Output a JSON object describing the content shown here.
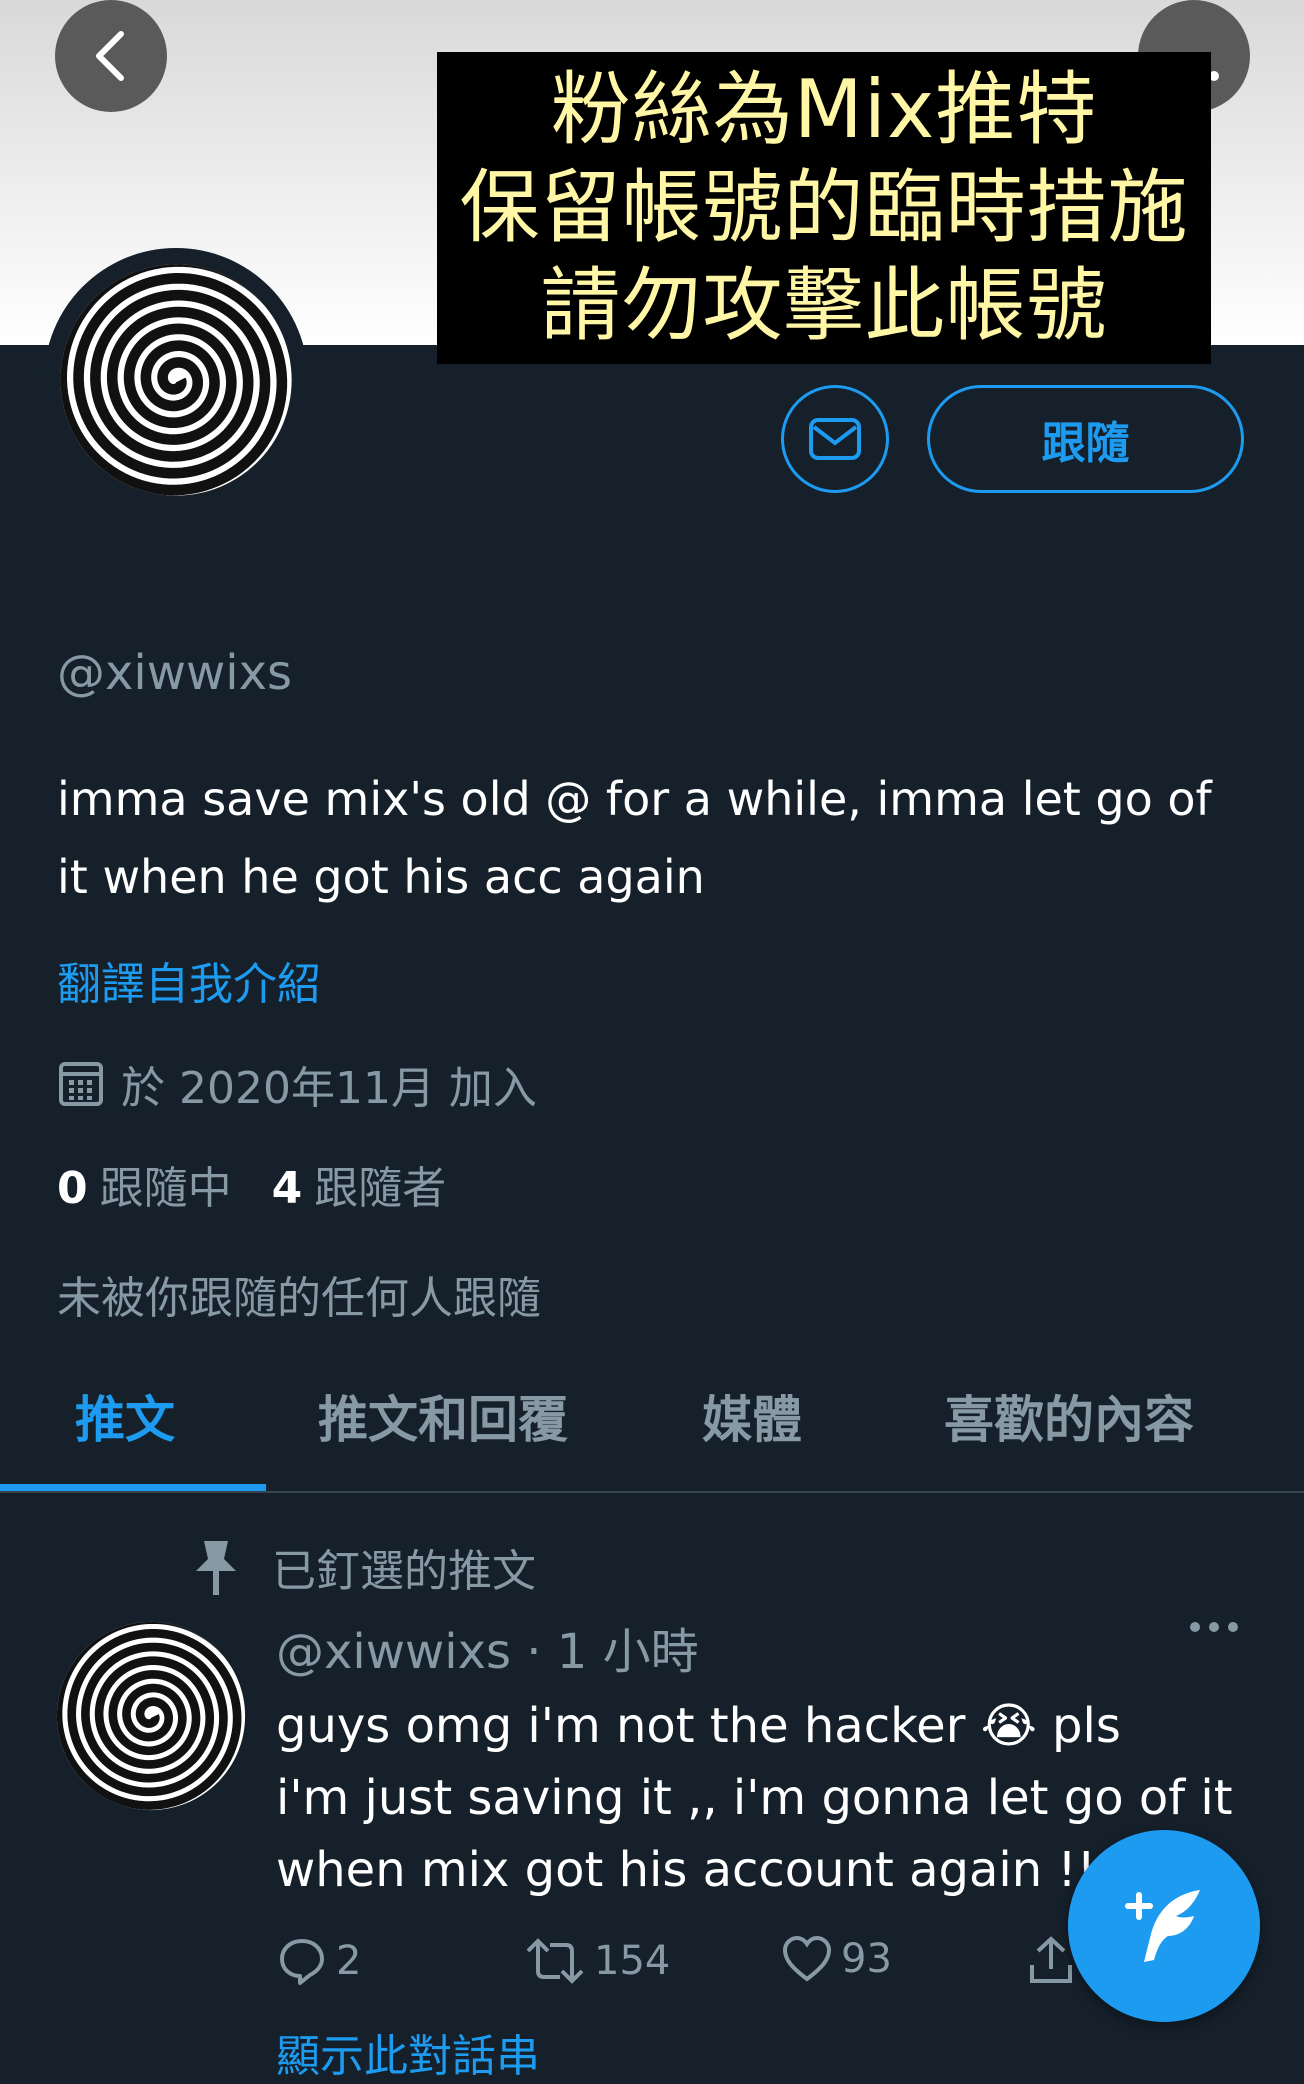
{
  "overlay": {
    "line1": "粉絲為Mix推特",
    "line2": "保留帳號的臨時措施",
    "line3": "請勿攻擊此帳號"
  },
  "profile": {
    "follow_label": "跟隨",
    "handle": "@xiwwixs",
    "bio": "imma save mix's old @ for a while, imma let go of it when he got his acc again",
    "translate": "翻譯自我介紹",
    "joined": "於 2020年11月 加入",
    "following_count": "0",
    "following_label": "跟隨中",
    "followers_count": "4",
    "followers_label": "跟隨者",
    "not_followed": "未被你跟隨的任何人跟隨"
  },
  "tabs": [
    {
      "label": "推文"
    },
    {
      "label": "推文和回覆"
    },
    {
      "label": "媒體"
    },
    {
      "label": "喜歡的內容"
    }
  ],
  "tweet": {
    "pinned_label": "已釘選的推文",
    "meta": "@xiwwixs · 1 小時",
    "text_line1": "guys omg i'm not the hacker 😭 pls",
    "text_line2": "i'm just saving it ,, i'm gonna let go of it",
    "text_line3": "when mix got his account again !!",
    "replies": "2",
    "retweets": "154",
    "likes": "93",
    "show_thread": "顯示此對話串"
  },
  "colors": {
    "background": "#15202b",
    "accent": "#1d9bf0",
    "muted": "#8899a6",
    "overlay_text": "#fff7a6"
  }
}
